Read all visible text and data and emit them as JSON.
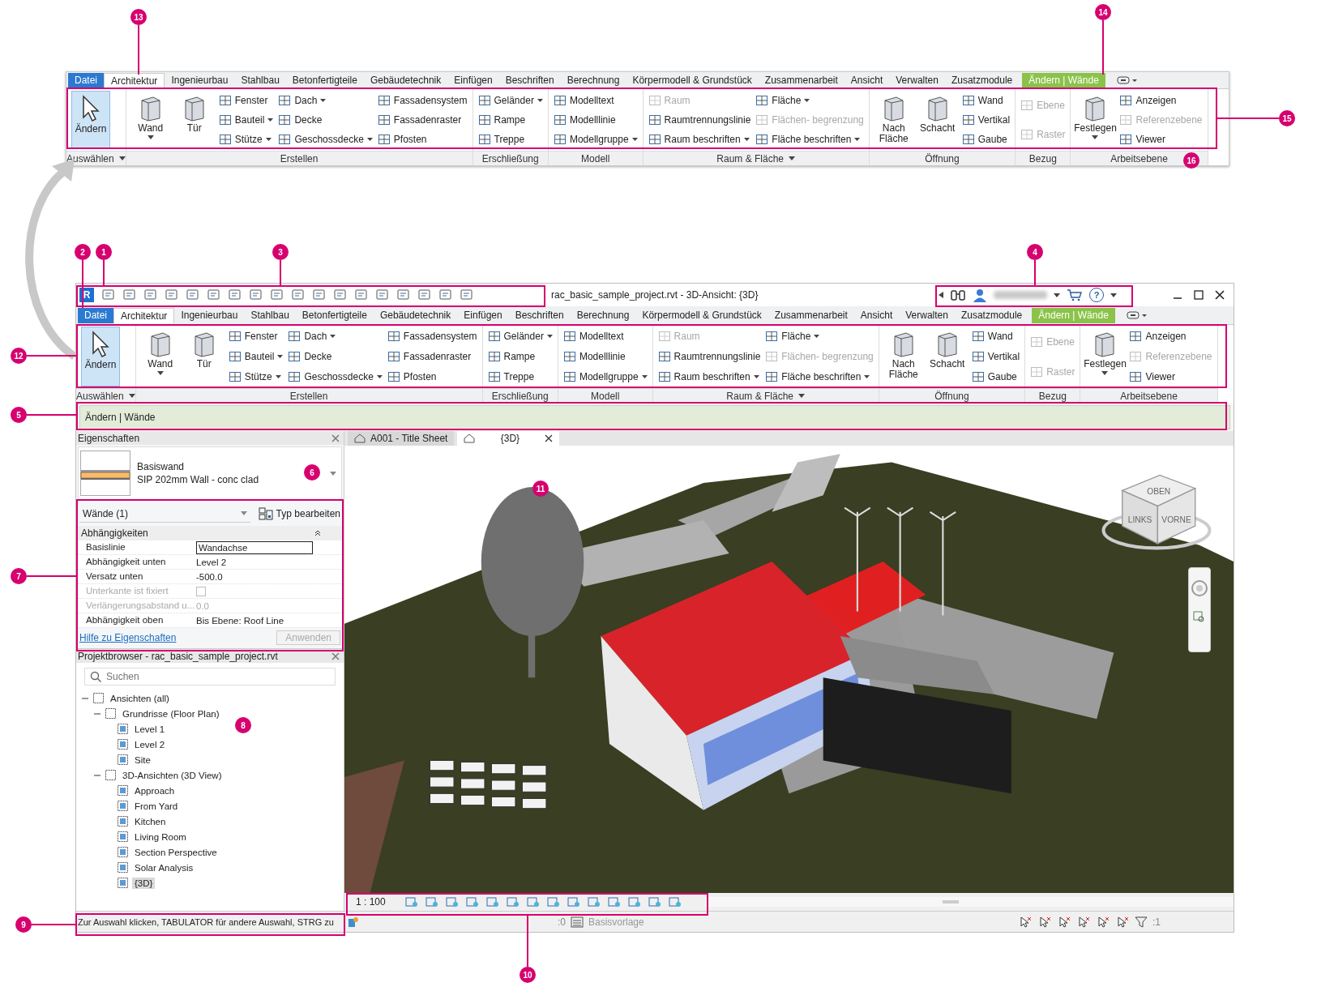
{
  "detail_ribbon": {
    "tabs": [
      {
        "label": "Datei",
        "kind": "file",
        "selected": false
      },
      {
        "label": "Architektur",
        "kind": "tab",
        "selected": true
      },
      {
        "label": "Ingenieurbau",
        "kind": "tab",
        "selected": false
      },
      {
        "label": "Stahlbau",
        "kind": "tab",
        "selected": false
      },
      {
        "label": "Betonfertigteile",
        "kind": "tab",
        "selected": false
      },
      {
        "label": "Gebäudetechnik",
        "kind": "tab",
        "selected": false
      },
      {
        "label": "Einfügen",
        "kind": "tab",
        "selected": false
      },
      {
        "label": "Beschriften",
        "kind": "tab",
        "selected": false
      },
      {
        "label": "Berechnung",
        "kind": "tab",
        "selected": false
      },
      {
        "label": "Körpermodell & Grundstück",
        "kind": "tab",
        "selected": false
      },
      {
        "label": "Zusammenarbeit",
        "kind": "tab",
        "selected": false
      },
      {
        "label": "Ansicht",
        "kind": "tab",
        "selected": false
      },
      {
        "label": "Verwalten",
        "kind": "tab",
        "selected": false
      },
      {
        "label": "Zusatzmodule",
        "kind": "tab",
        "selected": false
      },
      {
        "label": "Ändern | Wände",
        "kind": "context",
        "selected": false
      }
    ],
    "panels": [
      {
        "title": "Auswählen",
        "menu": true,
        "columns": [
          {
            "kind": "large",
            "label": "Ändern",
            "caret": false,
            "active": true
          }
        ]
      },
      {
        "title": "Erstellen",
        "menu": false,
        "columns": [
          {
            "kind": "large",
            "label": "Wand",
            "caret": true,
            "active": false
          },
          {
            "kind": "large",
            "label": "Tür",
            "caret": false,
            "active": false
          },
          {
            "kind": "stack",
            "items": [
              {
                "label": "Fenster",
                "caret": false,
                "disabled": false
              },
              {
                "label": "Bauteil",
                "caret": true,
                "disabled": false
              },
              {
                "label": "Stütze",
                "caret": true,
                "disabled": false
              }
            ]
          },
          {
            "kind": "stack",
            "items": [
              {
                "label": "Dach",
                "caret": true,
                "disabled": false
              },
              {
                "label": "Decke",
                "caret": false,
                "disabled": false
              },
              {
                "label": "Geschossdecke",
                "caret": true,
                "disabled": false
              }
            ]
          },
          {
            "kind": "stack",
            "items": [
              {
                "label": "Fassadensystem",
                "caret": false,
                "disabled": false
              },
              {
                "label": "Fassadenraster",
                "caret": false,
                "disabled": false
              },
              {
                "label": "Pfosten",
                "caret": false,
                "disabled": false
              }
            ]
          }
        ]
      },
      {
        "title": "Erschließung",
        "menu": false,
        "columns": [
          {
            "kind": "stack",
            "items": [
              {
                "label": "Geländer",
                "caret": true,
                "disabled": false
              },
              {
                "label": "Rampe",
                "caret": false,
                "disabled": false
              },
              {
                "label": "Treppe",
                "caret": false,
                "disabled": false
              }
            ]
          }
        ]
      },
      {
        "title": "Modell",
        "menu": false,
        "columns": [
          {
            "kind": "stack",
            "items": [
              {
                "label": "Modelltext",
                "caret": false,
                "disabled": false
              },
              {
                "label": "Modelllinie",
                "caret": false,
                "disabled": false
              },
              {
                "label": "Modellgruppe",
                "caret": true,
                "disabled": false
              }
            ]
          }
        ]
      },
      {
        "title": "Raum & Fläche",
        "menu": true,
        "columns": [
          {
            "kind": "stack",
            "items": [
              {
                "label": "Raum",
                "caret": false,
                "disabled": true
              },
              {
                "label": "Raumtrennungslinie",
                "caret": false,
                "disabled": false
              },
              {
                "label": "Raum beschriften",
                "caret": true,
                "disabled": false
              }
            ]
          },
          {
            "kind": "stack",
            "items": [
              {
                "label": "Fläche",
                "caret": true,
                "disabled": false
              },
              {
                "label": "Flächen- begrenzung",
                "caret": false,
                "disabled": true
              },
              {
                "label": "Fläche beschriften",
                "caret": true,
                "disabled": false
              }
            ]
          }
        ]
      },
      {
        "title": "Öffnung",
        "menu": false,
        "columns": [
          {
            "kind": "large",
            "label": "Nach Fläche",
            "caret": false,
            "active": false
          },
          {
            "kind": "large",
            "label": "Schacht",
            "caret": false,
            "active": false
          },
          {
            "kind": "stack",
            "items": [
              {
                "label": "Wand",
                "caret": false,
                "disabled": false
              },
              {
                "label": "Vertikal",
                "caret": false,
                "disabled": false
              },
              {
                "label": "Gaube",
                "caret": false,
                "disabled": false
              }
            ]
          }
        ]
      },
      {
        "title": "Bezug",
        "menu": false,
        "columns": [
          {
            "kind": "stack",
            "items": [
              {
                "label": "Ebene",
                "caret": false,
                "disabled": true
              },
              {
                "label": "Raster",
                "caret": false,
                "disabled": true
              }
            ]
          }
        ]
      },
      {
        "title": "Arbeitsebene",
        "menu": false,
        "columns": [
          {
            "kind": "large",
            "label": "Festlegen",
            "caret": true,
            "active": false
          },
          {
            "kind": "stack",
            "items": [
              {
                "label": "Anzeigen",
                "caret": false,
                "disabled": false
              },
              {
                "label": "Referenzebene",
                "caret": false,
                "disabled": true
              },
              {
                "label": "Viewer",
                "caret": false,
                "disabled": false
              }
            ]
          }
        ]
      }
    ]
  },
  "window": {
    "app_logo": "R",
    "title": "rac_basic_sample_project.rvt - 3D-Ansicht: {3D}",
    "help_glyph": "?",
    "ribbon": {
      "tabs": [
        {
          "label": "Datei",
          "kind": "file",
          "selected": false
        },
        {
          "label": "Architektur",
          "kind": "tab",
          "selected": true
        },
        {
          "label": "Ingenieurbau",
          "kind": "tab",
          "selected": false
        },
        {
          "label": "Stahlbau",
          "kind": "tab",
          "selected": false
        },
        {
          "label": "Betonfertigteile",
          "kind": "tab",
          "selected": false
        },
        {
          "label": "Gebäudetechnik",
          "kind": "tab",
          "selected": false
        },
        {
          "label": "Einfügen",
          "kind": "tab",
          "selected": false
        },
        {
          "label": "Beschriften",
          "kind": "tab",
          "selected": false
        },
        {
          "label": "Berechnung",
          "kind": "tab",
          "selected": false
        },
        {
          "label": "Körpermodell & Grundstück",
          "kind": "tab",
          "selected": false
        },
        {
          "label": "Zusammenarbeit",
          "kind": "tab",
          "selected": false
        },
        {
          "label": "Ansicht",
          "kind": "tab",
          "selected": false
        },
        {
          "label": "Verwalten",
          "kind": "tab",
          "selected": false
        },
        {
          "label": "Zusatzmodule",
          "kind": "tab",
          "selected": false
        },
        {
          "label": "Ändern | Wände",
          "kind": "context",
          "selected": false
        }
      ],
      "panels": [
        {
          "title": "Auswählen",
          "menu": true,
          "columns": [
            {
              "kind": "large",
              "label": "Ändern",
              "caret": false,
              "active": true
            }
          ]
        },
        {
          "title": "Erstellen",
          "menu": false,
          "columns": [
            {
              "kind": "large",
              "label": "Wand",
              "caret": true,
              "active": false
            },
            {
              "kind": "large",
              "label": "Tür",
              "caret": false,
              "active": false
            },
            {
              "kind": "stack",
              "items": [
                {
                  "label": "Fenster",
                  "caret": false,
                  "disabled": false
                },
                {
                  "label": "Bauteil",
                  "caret": true,
                  "disabled": false
                },
                {
                  "label": "Stütze",
                  "caret": true,
                  "disabled": false
                }
              ]
            },
            {
              "kind": "stack",
              "items": [
                {
                  "label": "Dach",
                  "caret": true,
                  "disabled": false
                },
                {
                  "label": "Decke",
                  "caret": false,
                  "disabled": false
                },
                {
                  "label": "Geschossdecke",
                  "caret": true,
                  "disabled": false
                }
              ]
            },
            {
              "kind": "stack",
              "items": [
                {
                  "label": "Fassadensystem",
                  "caret": false,
                  "disabled": false
                },
                {
                  "label": "Fassadenraster",
                  "caret": false,
                  "disabled": false
                },
                {
                  "label": "Pfosten",
                  "caret": false,
                  "disabled": false
                }
              ]
            }
          ]
        },
        {
          "title": "Erschließung",
          "menu": false,
          "columns": [
            {
              "kind": "stack",
              "items": [
                {
                  "label": "Geländer",
                  "caret": true,
                  "disabled": false
                },
                {
                  "label": "Rampe",
                  "caret": false,
                  "disabled": false
                },
                {
                  "label": "Treppe",
                  "caret": false,
                  "disabled": false
                }
              ]
            }
          ]
        },
        {
          "title": "Modell",
          "menu": false,
          "columns": [
            {
              "kind": "stack",
              "items": [
                {
                  "label": "Modelltext",
                  "caret": false,
                  "disabled": false
                },
                {
                  "label": "Modelllinie",
                  "caret": false,
                  "disabled": false
                },
                {
                  "label": "Modellgruppe",
                  "caret": true,
                  "disabled": false
                }
              ]
            }
          ]
        },
        {
          "title": "Raum & Fläche",
          "menu": true,
          "columns": [
            {
              "kind": "stack",
              "items": [
                {
                  "label": "Raum",
                  "caret": false,
                  "disabled": true
                },
                {
                  "label": "Raumtrennungslinie",
                  "caret": false,
                  "disabled": false
                },
                {
                  "label": "Raum beschriften",
                  "caret": true,
                  "disabled": false
                }
              ]
            },
            {
              "kind": "stack",
              "items": [
                {
                  "label": "Fläche",
                  "caret": true,
                  "disabled": false
                },
                {
                  "label": "Flächen- begrenzung",
                  "caret": false,
                  "disabled": true
                },
                {
                  "label": "Fläche beschriften",
                  "caret": true,
                  "disabled": false
                }
              ]
            }
          ]
        },
        {
          "title": "Öffnung",
          "menu": false,
          "columns": [
            {
              "kind": "large",
              "label": "Nach Fläche",
              "caret": false,
              "active": false
            },
            {
              "kind": "large",
              "label": "Schacht",
              "caret": false,
              "active": false
            },
            {
              "kind": "stack",
              "items": [
                {
                  "label": "Wand",
                  "caret": false,
                  "disabled": false
                },
                {
                  "label": "Vertikal",
                  "caret": false,
                  "disabled": false
                },
                {
                  "label": "Gaube",
                  "caret": false,
                  "disabled": false
                }
              ]
            }
          ]
        },
        {
          "title": "Bezug",
          "menu": false,
          "columns": [
            {
              "kind": "stack",
              "items": [
                {
                  "label": "Ebene",
                  "caret": false,
                  "disabled": true
                },
                {
                  "label": "Raster",
                  "caret": false,
                  "disabled": true
                }
              ]
            }
          ]
        },
        {
          "title": "Arbeitsebene",
          "menu": false,
          "columns": [
            {
              "kind": "large",
              "label": "Festlegen",
              "caret": true,
              "active": false
            },
            {
              "kind": "stack",
              "items": [
                {
                  "label": "Anzeigen",
                  "caret": false,
                  "disabled": false
                },
                {
                  "label": "Referenzebene",
                  "caret": false,
                  "disabled": true
                },
                {
                  "label": "Viewer",
                  "caret": false,
                  "disabled": false
                }
              ]
            }
          ]
        }
      ]
    },
    "options_bar": "Ändern | Wände",
    "properties": {
      "title": "Eigenschaften",
      "type_family": "Basiswand",
      "type_name": "SIP 202mm Wall - conc clad",
      "instance_filter": "Wände (1)",
      "edit_type": "Typ bearbeiten",
      "group": "Abhängigkeiten",
      "rows": [
        {
          "label": "Basislinie",
          "value": "Wandachse",
          "kind": "field",
          "disabled": false
        },
        {
          "label": "Abhängigkeit unten",
          "value": "Level 2",
          "kind": "text",
          "disabled": false
        },
        {
          "label": "Versatz unten",
          "value": "-500.0",
          "kind": "text",
          "disabled": false
        },
        {
          "label": "Unterkante ist fixiert",
          "kind": "checkbox",
          "checked": false,
          "disabled": true
        },
        {
          "label": "Verlängerungsabstand u...",
          "value": "0.0",
          "kind": "text",
          "disabled": true
        },
        {
          "label": "Abhängigkeit oben",
          "value": "Bis Ebene: Roof Line",
          "kind": "text",
          "disabled": false
        }
      ],
      "help_link": "Hilfe zu Eigenschaften",
      "apply": "Anwenden",
      "apply_disabled": true
    },
    "project_browser": {
      "title": "Projektbrowser - rac_basic_sample_project.rvt",
      "search_placeholder": "Suchen",
      "tree": [
        {
          "label": "Ansichten (all)",
          "expanded": true,
          "selected": false,
          "children": [
            {
              "label": "Grundrisse (Floor Plan)",
              "expanded": true,
              "selected": false,
              "children": [
                {
                  "label": "Level 1",
                  "selected": false
                },
                {
                  "label": "Level 2",
                  "selected": false
                },
                {
                  "label": "Site",
                  "selected": false
                }
              ]
            },
            {
              "label": "3D-Ansichten (3D View)",
              "expanded": true,
              "selected": false,
              "children": [
                {
                  "label": "Approach",
                  "selected": false
                },
                {
                  "label": "From Yard",
                  "selected": false
                },
                {
                  "label": "Kitchen",
                  "selected": false
                },
                {
                  "label": "Living Room",
                  "selected": false
                },
                {
                  "label": "Section Perspective",
                  "selected": false
                },
                {
                  "label": "Solar Analysis",
                  "selected": false
                },
                {
                  "label": "{3D}",
                  "selected": true
                }
              ]
            }
          ]
        }
      ]
    },
    "view_tabs": [
      {
        "label": "A001 - Title Sheet",
        "selected": false
      },
      {
        "label": "{3D}",
        "selected": true
      }
    ],
    "view_cube": {
      "top": "OBEN",
      "left": "LINKS",
      "front": "VORNE"
    },
    "view_scale": "1 : 100",
    "status_bar": {
      "prompt": "Zur Auswahl klicken, TABULATOR für andere Auswahl, STRG zu",
      "worksets": ":0",
      "design_option": "Basisvorlage",
      "filter_count": ":1"
    }
  },
  "callouts": [
    "13",
    "14",
    "15",
    "16",
    "2",
    "1",
    "3",
    "4",
    "12",
    "5",
    "6",
    "11",
    "7",
    "8",
    "9",
    "10"
  ]
}
